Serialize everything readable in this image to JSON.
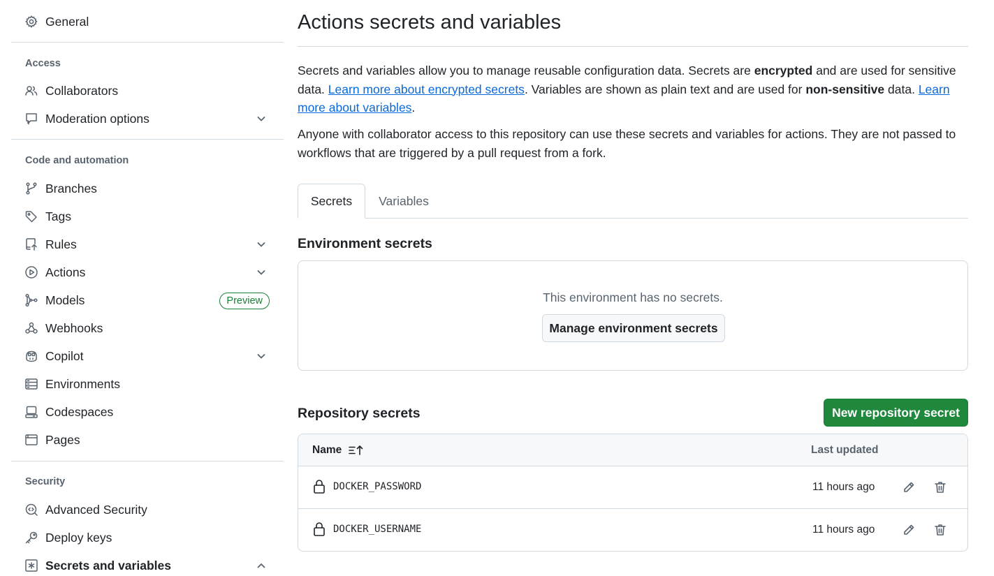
{
  "sidebar": {
    "general": "General",
    "groups": {
      "access": "Access",
      "code": "Code and automation",
      "security": "Security"
    },
    "access_items": [
      {
        "label": "Collaborators",
        "icon": "people-icon"
      },
      {
        "label": "Moderation options",
        "icon": "report-icon"
      }
    ],
    "code_items": [
      {
        "label": "Branches",
        "icon": "git-branch-icon"
      },
      {
        "label": "Tags",
        "icon": "tag-icon"
      },
      {
        "label": "Rules",
        "icon": "repo-push-icon"
      },
      {
        "label": "Actions",
        "icon": "play-icon"
      },
      {
        "label": "Models",
        "icon": "models-icon",
        "badge": "Preview"
      },
      {
        "label": "Webhooks",
        "icon": "webhook-icon"
      },
      {
        "label": "Copilot",
        "icon": "copilot-icon"
      },
      {
        "label": "Environments",
        "icon": "server-icon"
      },
      {
        "label": "Codespaces",
        "icon": "codespaces-icon"
      },
      {
        "label": "Pages",
        "icon": "browser-icon"
      }
    ],
    "security_items": [
      {
        "label": "Advanced Security",
        "icon": "codescan-icon"
      },
      {
        "label": "Deploy keys",
        "icon": "key-icon"
      },
      {
        "label": "Secrets and variables",
        "icon": "asterisk-icon",
        "active": true
      }
    ]
  },
  "main": {
    "title": "Actions secrets and variables",
    "intro": {
      "p1_a": "Secrets and variables allow you to manage reusable configuration data. Secrets are ",
      "p1_b": "encrypted",
      "p1_c": " and are used for sensitive data. ",
      "link1": "Learn more about encrypted secrets",
      "p1_d": ". Variables are shown as plain text and are used for ",
      "p1_e": "non-sensitive",
      "p1_f": " data. ",
      "link2": "Learn more about variables",
      "p1_g": ".",
      "p2": "Anyone with collaborator access to this repository can use these secrets and variables for actions. They are not passed to workflows that are triggered by a pull request from a fork."
    },
    "tabs": {
      "secrets": "Secrets",
      "variables": "Variables"
    },
    "env_secrets": {
      "title": "Environment secrets",
      "empty_text": "This environment has no secrets.",
      "manage_button": "Manage environment secrets"
    },
    "repo_secrets": {
      "title": "Repository secrets",
      "new_button": "New repository secret",
      "col_name": "Name",
      "col_updated": "Last updated",
      "rows": [
        {
          "name": "DOCKER_PASSWORD",
          "updated": "11 hours ago"
        },
        {
          "name": "DOCKER_USERNAME",
          "updated": "11 hours ago"
        }
      ]
    }
  },
  "colors": {
    "primary_button": "#1f883d",
    "link": "#0969da",
    "badge": "#1a7f37",
    "border": "#d1d9e0"
  }
}
